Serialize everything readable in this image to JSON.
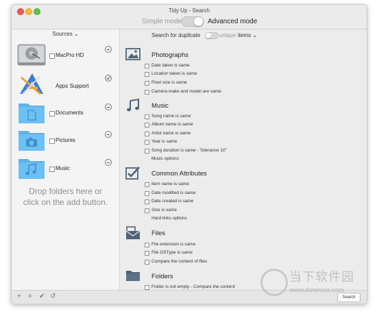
{
  "window": {
    "title": "Tidy Up - Search",
    "mode_simple": "Simple mode",
    "mode_advanced": "Advanced mode"
  },
  "sidebar": {
    "header": "Sources ⌄",
    "sources": [
      {
        "label": "MacPro HD",
        "icon": "hard-drive-icon"
      },
      {
        "label": "Apps Support",
        "icon": "apps-support-icon"
      },
      {
        "label": "Documents",
        "icon": "documents-folder-icon"
      },
      {
        "label": "Pictures",
        "icon": "pictures-folder-icon"
      },
      {
        "label": "Music",
        "icon": "music-folder-icon"
      }
    ],
    "drop_hint_line1": "Drop folders here or",
    "drop_hint_line2": "click on the add button."
  },
  "search_header": {
    "prefix": "Search for duplicate",
    "unique": "unique",
    "items": "items ⌄"
  },
  "sections": {
    "photographs": {
      "title": "Photographs",
      "options": [
        "Date taken is same",
        "Location taken is same",
        "Pixel size is same",
        "Camera make and model are same"
      ]
    },
    "music": {
      "title": "Music",
      "options": [
        "Song name is same",
        "Album name is same",
        "Artist name is same",
        "Year is same",
        "Song duration is same - Tolerance 10\""
      ],
      "link": "Music options"
    },
    "common": {
      "title": "Common Attributes",
      "options": [
        "Item name is same",
        "Date modified is same",
        "Date created is same",
        "Size is same"
      ],
      "link": "Hard links options"
    },
    "files": {
      "title": "Files",
      "options": [
        "File extension is same",
        "File OSType is same",
        "Compare the content of files"
      ]
    },
    "folders": {
      "title": "Folders",
      "options": [
        "Folder is not empty - Compare the content"
      ]
    }
  },
  "bottombar": {
    "add": "+",
    "remove": "×",
    "check": "✔",
    "revert": "↺",
    "search_button": "Search"
  },
  "watermark": {
    "cn": "当下软件园",
    "url": "www.downxia.com"
  },
  "colors": {
    "window_bg": "#ececec",
    "sidebar_bg": "#f4f4f4",
    "folder_blue": "#62b8ee",
    "icon_gray": "#4f6376"
  }
}
